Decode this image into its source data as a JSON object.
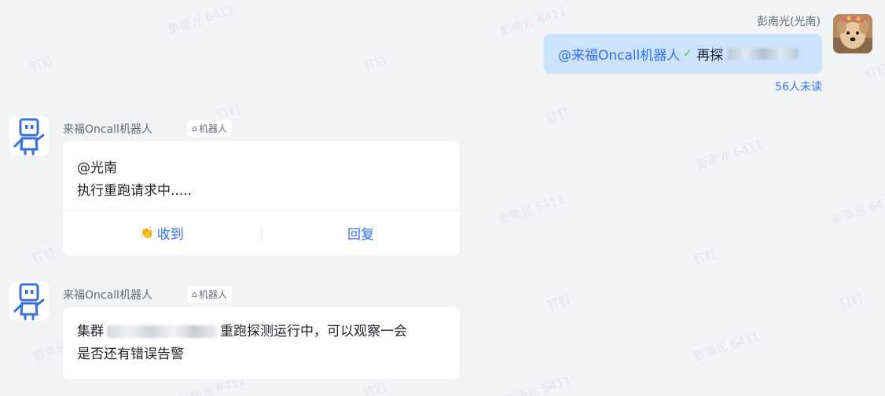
{
  "watermarks": [
    "彭南光 6411",
    "钉钉",
    "钉钉",
    "彭南光 6411",
    "彭南光 6411",
    "钉钉",
    "彭南光 6411",
    "钉钉",
    "彭南光 6411",
    "钉钉",
    "彭南光 6411",
    "钉钉",
    "钉钉",
    "彭南光 6411",
    "彭南光 6411",
    "钉钉",
    "彭南光 6411",
    "钉钉",
    "钉钉",
    "彭南光 6411"
  ],
  "own_message": {
    "sender": "彭南光(光南)",
    "mention": "@来福Oncall机器人",
    "text": "再探",
    "read_status": "56人未读"
  },
  "bot_message_1": {
    "name": "来福Oncall机器人",
    "tag": "机器人",
    "line1": "@光南",
    "line2": "执行重跑请求中.....",
    "action_ack": "收到",
    "action_reply": "回复"
  },
  "bot_message_2": {
    "name": "来福Oncall机器人",
    "tag": "机器人",
    "text_prefix": "集群",
    "text_suffix": "重跑探测运行中，可以观察一会",
    "line2": "是否还有错误告警"
  },
  "colors": {
    "background": "#f2f3f5",
    "own_bubble": "#cce3ff",
    "link": "#3370ff",
    "robot": "#3a6fd8"
  }
}
